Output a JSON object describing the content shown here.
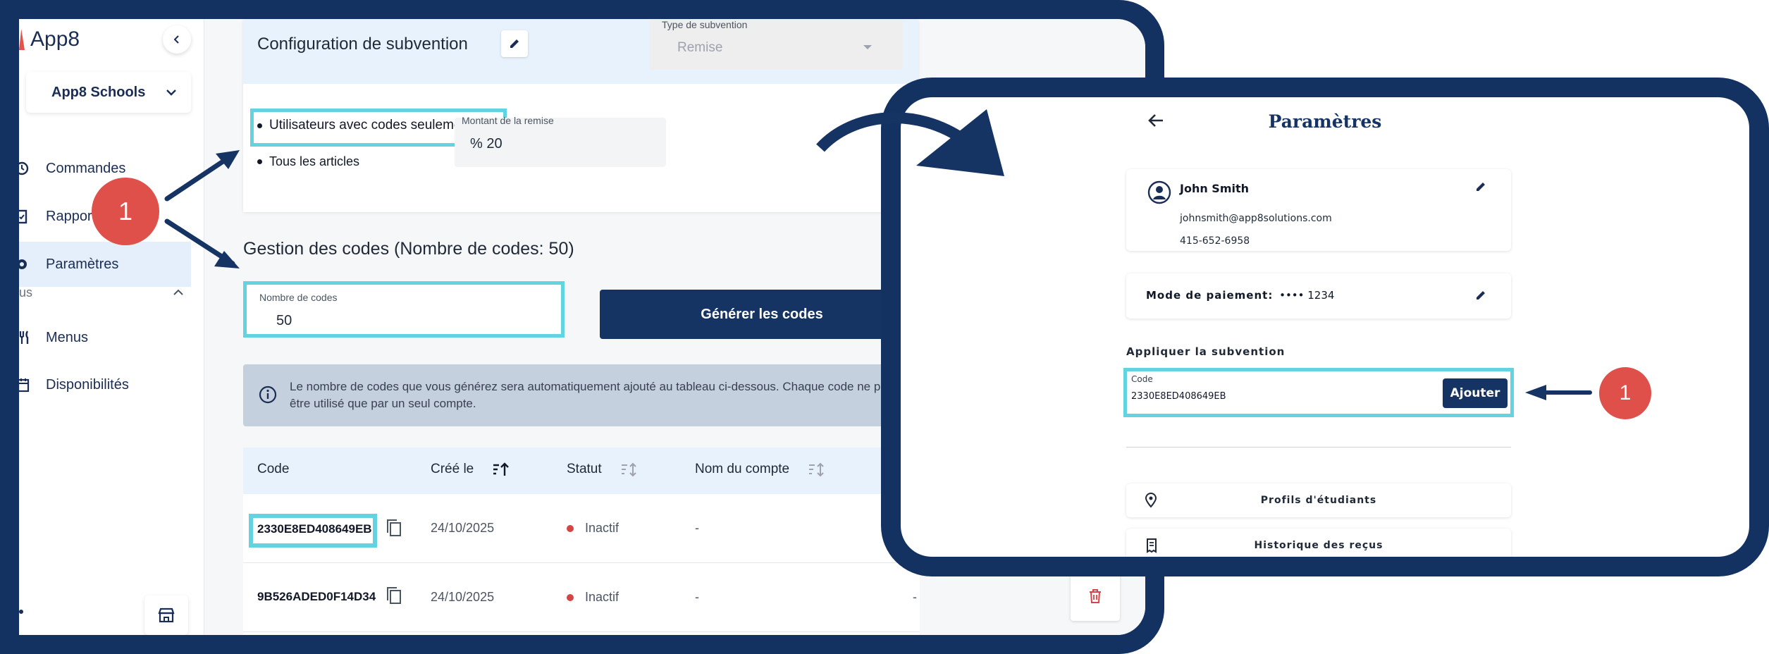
{
  "admin": {
    "logo_text": "App8",
    "school_select": "App8 Schools",
    "nav": {
      "commandes": "Commandes",
      "rapports": "Rapports",
      "parametres": "Paramètres",
      "section_label": "us",
      "menus": "Menus",
      "disponibilites": "Disponibilités"
    },
    "config": {
      "title": "Configuration de subvention",
      "type_label": "Type de subvention",
      "type_value": "Remise",
      "option_codes_only": "Utilisateurs avec codes seulement",
      "option_all_items": "Tous les articles",
      "amount_label": "Montant de la remise",
      "amount_value": "% 20"
    },
    "codes": {
      "title": "Gestion des codes (Nombre de codes: 50)",
      "count_label": "Nombre de codes",
      "count_value": "50",
      "generate_button": "Générer les codes",
      "info_text": "Le nombre de codes que vous générez sera automatiquement ajouté au tableau ci-dessous. Chaque code ne peut être utilisé que par un seul compte."
    },
    "table": {
      "headers": [
        "Code",
        "Créé le",
        "Statut",
        "Nom du compte"
      ],
      "rows": [
        {
          "code": "2330E8ED408649EB",
          "created": "24/10/2025",
          "status": "Inactif",
          "account": "-",
          "extra": ""
        },
        {
          "code": "9B526ADED0F14D34",
          "created": "24/10/2025",
          "status": "Inactif",
          "account": "-",
          "extra": "-"
        }
      ]
    }
  },
  "mobile": {
    "title": "Paramètres",
    "profile": {
      "name": "John Smith",
      "email": "johnsmith@app8solutions.com",
      "phone": "415-652-6958"
    },
    "payment": {
      "label": "Mode de paiement:",
      "value": "•••• 1234"
    },
    "apply_title": "Appliquer la subvention",
    "code_label": "Code",
    "code_value": "2330E8ED408649EB",
    "add_button": "Ajouter",
    "links": [
      "Profils d'étudiants",
      "Historique des reçus"
    ]
  },
  "annotations": {
    "step_left": "1",
    "step_right": "1",
    "highlight_color": "#62d3df",
    "badge_color": "#e0504a",
    "frame_color": "#133262"
  }
}
